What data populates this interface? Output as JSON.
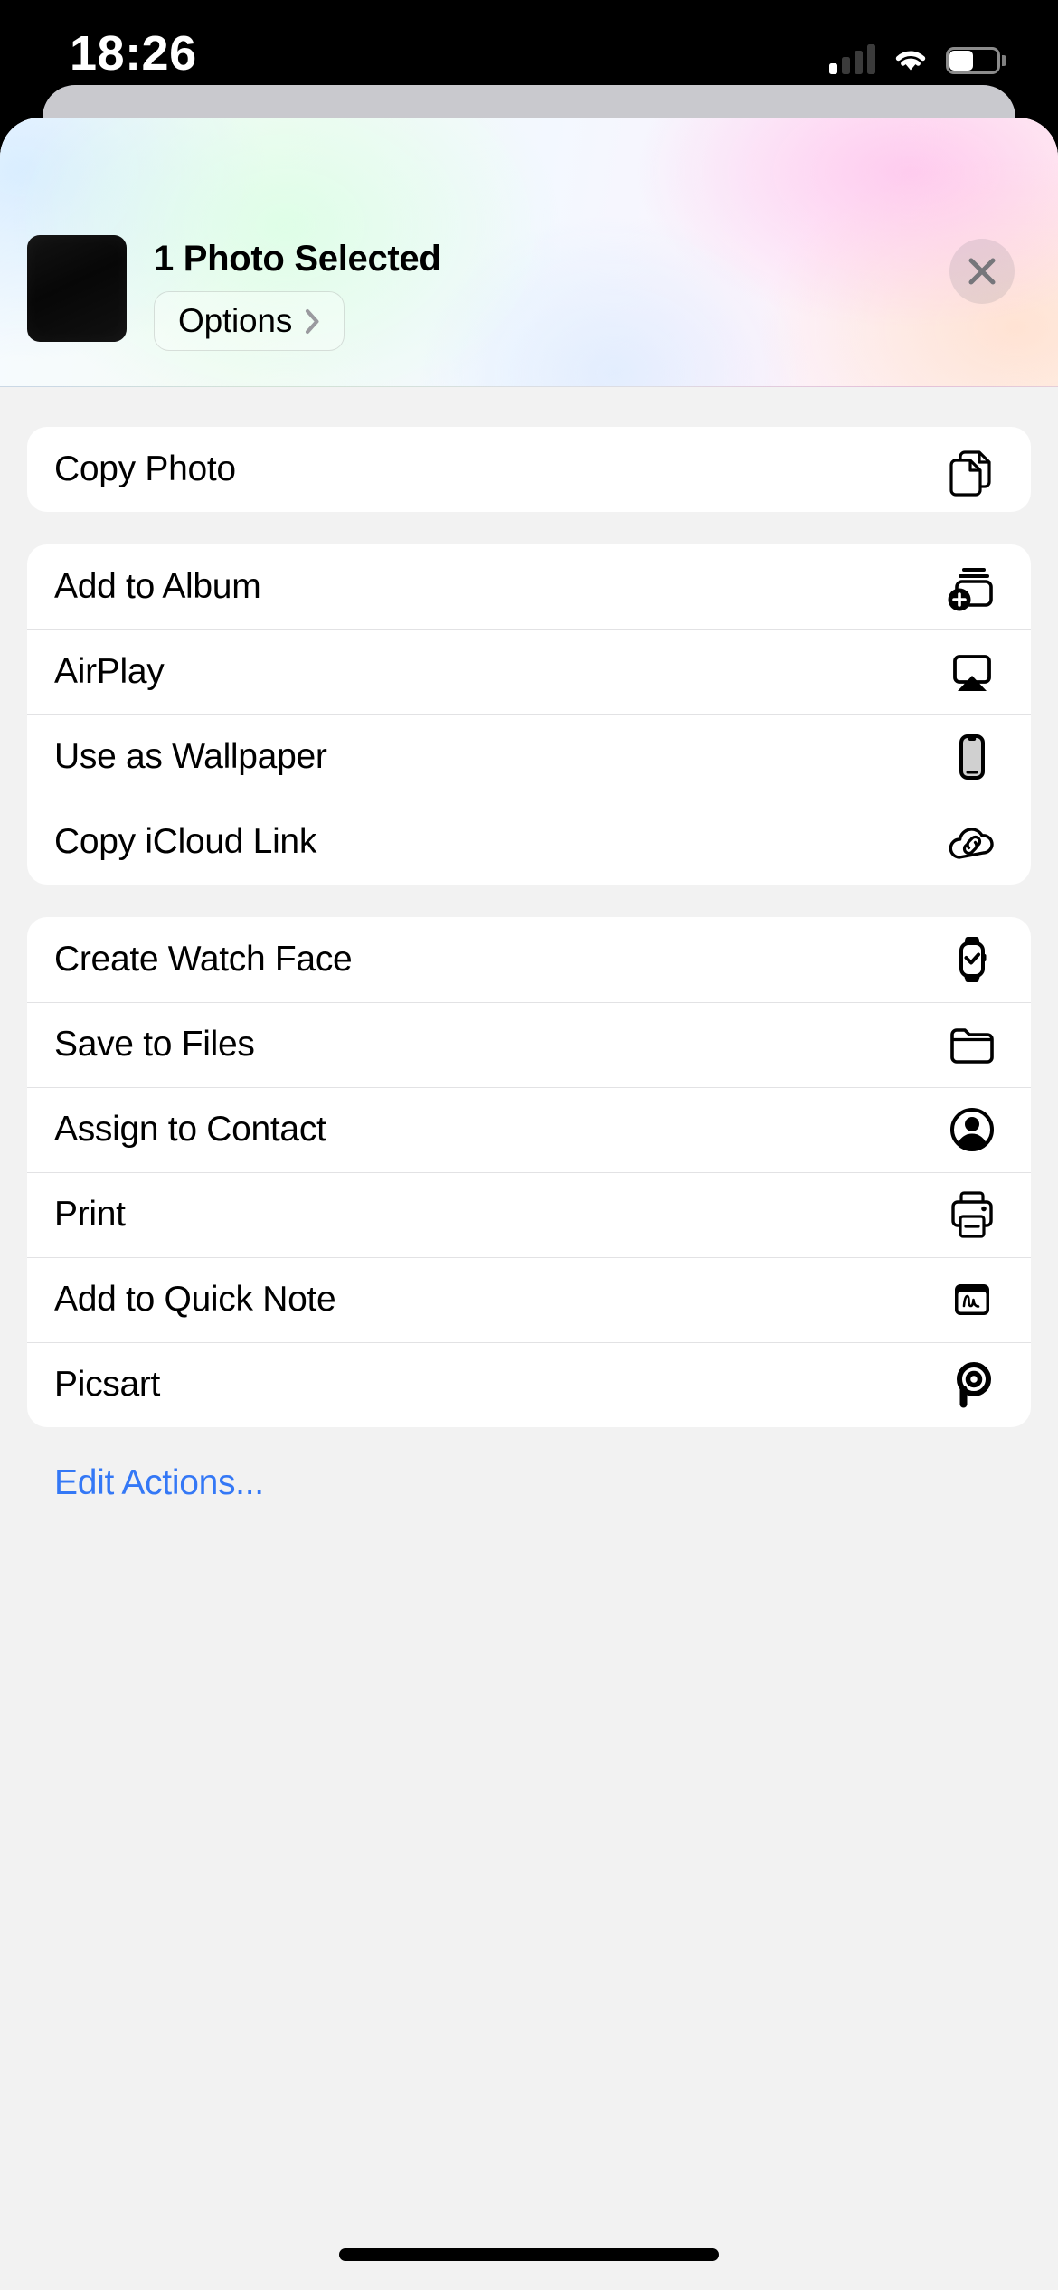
{
  "status_bar": {
    "time": "18:26",
    "cellular_icon": "cellular-signal-icon",
    "cellular_bars_active": 1,
    "cellular_bars_total": 4,
    "wifi_icon": "wifi-icon",
    "wifi_strength": "full",
    "battery_icon": "battery-icon",
    "battery_percent": 43
  },
  "header": {
    "title": "1 Photo Selected",
    "thumbnail_name": "photo-thumbnail",
    "options_label": "Options",
    "options_chevron_icon": "chevron-right-icon",
    "close_icon": "close-icon",
    "gradient_colors": [
      "#f7fbff",
      "#f4fbf6",
      "#f3f8ff",
      "#fdf2fb",
      "#fff6f2"
    ]
  },
  "groups": [
    {
      "name": "clipboard-group",
      "rows": [
        {
          "label": "Copy Photo",
          "icon": "copy-documents-icon"
        }
      ]
    },
    {
      "name": "photo-actions-group",
      "rows": [
        {
          "label": "Add to Album",
          "icon": "add-to-album-icon"
        },
        {
          "label": "AirPlay",
          "icon": "airplay-icon"
        },
        {
          "label": "Use as Wallpaper",
          "icon": "iphone-wallpaper-icon"
        },
        {
          "label": "Copy iCloud Link",
          "icon": "icloud-link-icon"
        }
      ]
    },
    {
      "name": "system-actions-group",
      "rows": [
        {
          "label": "Create Watch Face",
          "icon": "apple-watch-icon"
        },
        {
          "label": "Save to Files",
          "icon": "folder-icon"
        },
        {
          "label": "Assign to Contact",
          "icon": "contact-person-icon"
        },
        {
          "label": "Print",
          "icon": "printer-icon"
        },
        {
          "label": "Add to Quick Note",
          "icon": "quick-note-icon"
        },
        {
          "label": "Picsart",
          "icon": "picsart-logo-icon"
        }
      ]
    }
  ],
  "footer": {
    "edit_actions_label": "Edit Actions...",
    "edit_actions_color": "#3478f6"
  },
  "home_indicator": "home-indicator"
}
